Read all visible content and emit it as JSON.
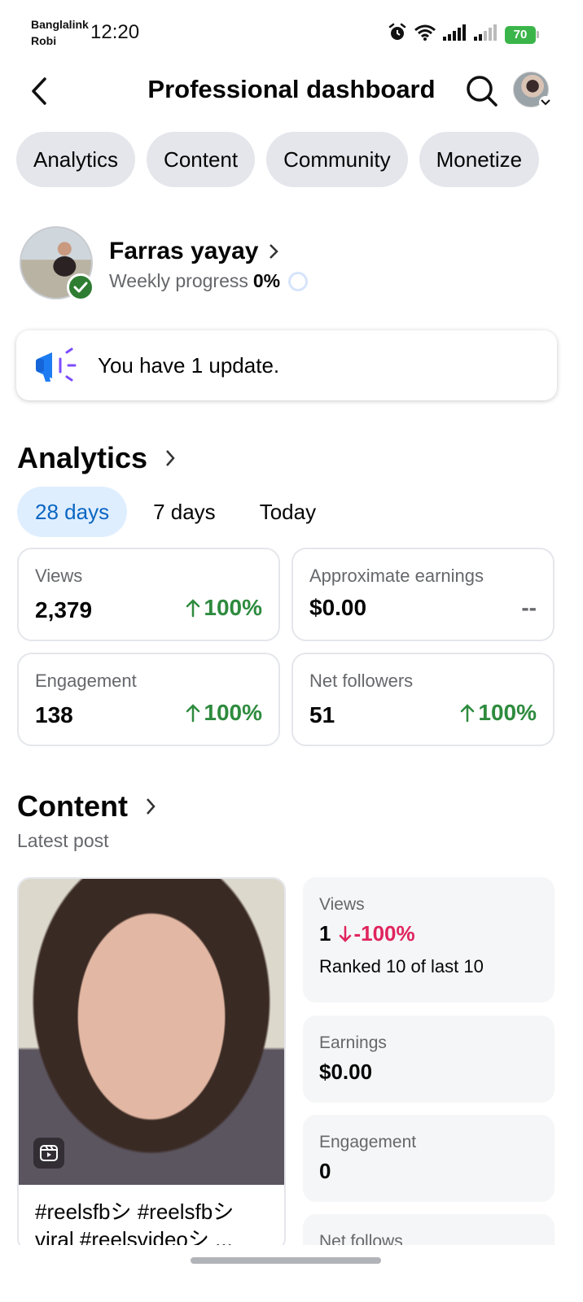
{
  "status_bar": {
    "carrier_1": "Banglalink",
    "carrier_2": "Robi",
    "time": "12:20",
    "battery": "70",
    "icons": [
      "alarm-icon",
      "wifi-icon",
      "signal-icon",
      "signal-weak-icon",
      "battery-charging-icon"
    ]
  },
  "header": {
    "title": "Professional dashboard",
    "back_icon": "chevron-left-icon",
    "search_icon": "search-icon"
  },
  "tabs": [
    "Analytics",
    "Content",
    "Community",
    "Monetize"
  ],
  "profile": {
    "name": "Farras yayay",
    "progress_label": "Weekly progress",
    "progress_value": "0%"
  },
  "update": {
    "text": "You have 1 update.",
    "icon": "megaphone-icon"
  },
  "analytics": {
    "title": "Analytics",
    "ranges": [
      "28 days",
      "7 days",
      "Today"
    ],
    "active_range": "28 days",
    "metrics": [
      {
        "label": "Views",
        "value": "2,379",
        "change": "100%",
        "trend": "up"
      },
      {
        "label": "Approximate earnings",
        "value": "$0.00",
        "change": "--",
        "trend": "none"
      },
      {
        "label": "Engagement",
        "value": "138",
        "change": "100%",
        "trend": "up"
      },
      {
        "label": "Net followers",
        "value": "51",
        "change": "100%",
        "trend": "up"
      }
    ]
  },
  "content": {
    "title": "Content",
    "subtitle": "Latest post",
    "post": {
      "caption_line1": "#reelsfbシ #reelsfbシ",
      "caption_line2": "viral #reelsvideoシ ..."
    },
    "stats": {
      "views_label": "Views",
      "views_value": "1",
      "views_change": "-100%",
      "views_rank": "Ranked 10 of last 10",
      "earnings_label": "Earnings",
      "earnings_value": "$0.00",
      "engagement_label": "Engagement",
      "engagement_value": "0",
      "follows_label": "Net follows"
    }
  },
  "colors": {
    "positive": "#2e8b3e",
    "negative": "#e0245e",
    "accent": "#0a66c2",
    "chip": "#e4e6eb"
  }
}
